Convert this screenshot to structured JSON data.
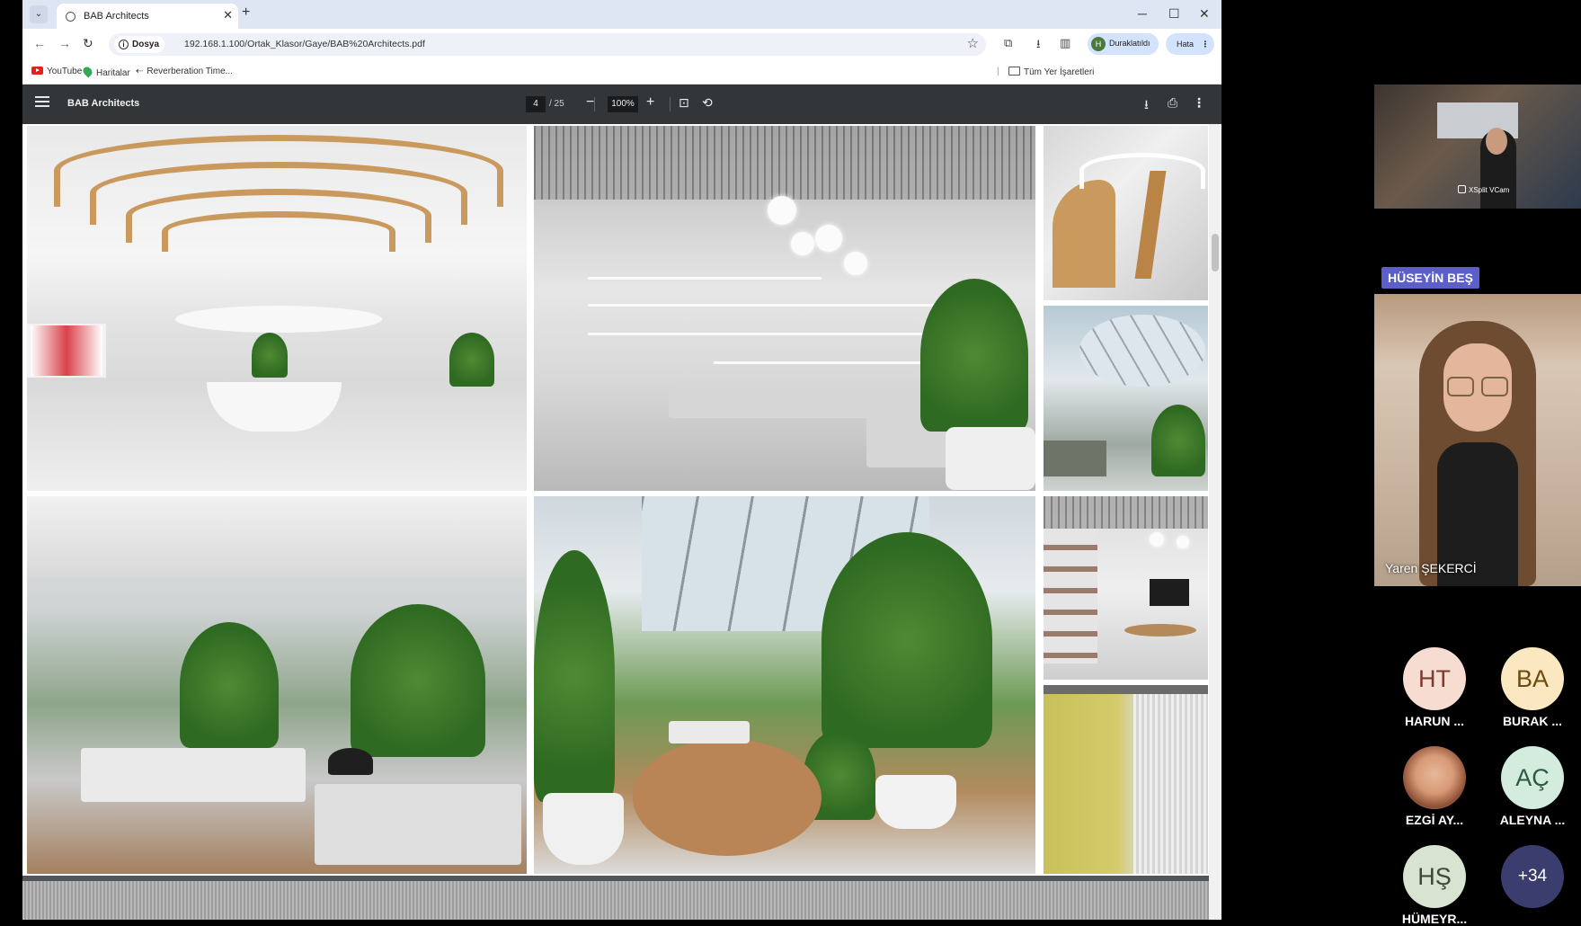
{
  "browser": {
    "tab_title": "BAB Architects",
    "site_info_label": "Dosya",
    "url": "192.168.1.100/Ortak_Klasor/Gaye/BAB%20Architects.pdf",
    "profile_initial": "H",
    "profile_label": "Duraklatıldı",
    "error_label": "Hata",
    "bookmarks": [
      "YouTube",
      "Haritalar",
      "Reverberation Time..."
    ],
    "all_bookmarks": "Tüm Yer İşaretleri"
  },
  "pdf": {
    "title": "BAB Architects",
    "current_page": "4",
    "total_pages": "/ 25",
    "zoom": "100%"
  },
  "meeting": {
    "camera_label": "XSplit VCam",
    "speaker_tag": "HÜSEYİN BEŞ",
    "main_speaker_name": "Yaren ŞEKERCİ",
    "participants": [
      {
        "initials": "HT",
        "name": "HARUN ...",
        "bg": "#f7dcd2",
        "fg": "#7a3b2e"
      },
      {
        "initials": "BA",
        "name": "BURAK ...",
        "bg": "#fbe8c0",
        "fg": "#6e4a12"
      },
      {
        "initials": "",
        "name": "EZGİ AY...",
        "bg": "#d9a07f",
        "fg": "#000000"
      },
      {
        "initials": "AÇ",
        "name": "ALEYNA ...",
        "bg": "#d3ecde",
        "fg": "#2b5a3f"
      },
      {
        "initials": "HŞ",
        "name": "HÜMEYR...",
        "bg": "#d8e3d2",
        "fg": "#3c4a34"
      },
      {
        "initials": "+34",
        "name": "",
        "bg": "#3b3d6e",
        "fg": "#ffffff"
      }
    ]
  }
}
